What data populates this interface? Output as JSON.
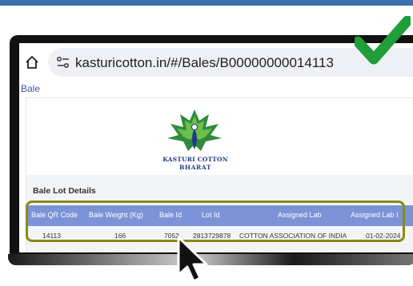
{
  "browser": {
    "url": "kasturicotton.in/#/Bales/B00000000014113",
    "icons": {
      "home": "home-icon",
      "site_info": "tune-icon"
    }
  },
  "page": {
    "tab_label": "Bale",
    "logo": {
      "line1": "KASTURI COTTON",
      "line2": "BHARAT",
      "colors": {
        "leaf": "#2e8b3a",
        "leaf_light": "#6cbf4a",
        "text": "#1f3a8a"
      }
    },
    "section_title": "Bale Lot Details",
    "table": {
      "headers": [
        "Bale QR Code",
        "Bale Weight (Kg)",
        "Bale Id",
        "Lot Id",
        "Assigned Lab",
        "Assigned Lab I"
      ],
      "rows": [
        [
          "14113",
          "166",
          "7052",
          "2813729878",
          "COTTON ASSOCIATION OF INDIA",
          "01-02-2024"
        ]
      ]
    }
  },
  "overlay": {
    "check_icon": "checkmark-icon",
    "cursor_icon": "mouse-pointer-icon",
    "colors": {
      "check": "#1f9e3a",
      "highlight": "#8a8a12",
      "header": "#7c93d8",
      "top_bar": "#3b6fb0"
    }
  }
}
